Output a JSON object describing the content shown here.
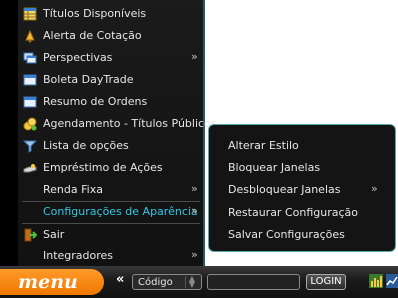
{
  "menu": {
    "items": [
      {
        "label": "Títulos Disponíveis",
        "icon": "table-icon"
      },
      {
        "label": "Alerta de Cotação",
        "icon": "bell-icon"
      },
      {
        "label": "Perspectivas",
        "icon": "windows-icon",
        "arrow": "»"
      },
      {
        "label": "Boleta DayTrade",
        "icon": "window-icon"
      },
      {
        "label": "Resumo de Ordens",
        "icon": "window-icon"
      },
      {
        "label": "Agendamento - Títulos Públicos",
        "icon": "coins-icon"
      },
      {
        "label": "Lista de opções",
        "icon": "filter-icon"
      },
      {
        "label": "Empréstimo de Ações",
        "icon": "hand-icon"
      },
      {
        "label": "Renda Fixa",
        "arrow": "»"
      },
      {
        "label": "Configurações de Aparência",
        "arrow": "»",
        "active": true
      },
      {
        "label": "Sair",
        "icon": "exit-door-icon"
      },
      {
        "label": "Integradores",
        "arrow": "»"
      }
    ]
  },
  "submenu": {
    "items": [
      {
        "label": "Alterar Estilo"
      },
      {
        "label": "Bloquear Janelas"
      },
      {
        "label": "Desbloquear Janelas",
        "arrow": "»"
      },
      {
        "label": "Restaurar Configuração"
      },
      {
        "label": "Salvar Configurações"
      }
    ]
  },
  "bottom_bar": {
    "menu_label": "menu",
    "collapse_glyph": "«",
    "select_value": "Código",
    "code_value": "",
    "login_label": "LOGIN"
  },
  "colors": {
    "accent": "#f07800",
    "active_text": "#34c8e6",
    "border": "#5aa9a9"
  }
}
